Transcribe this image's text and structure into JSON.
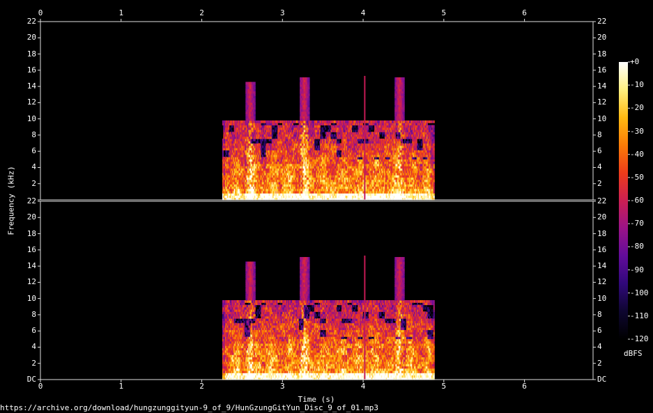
{
  "source_url": "https://archive.org/download/hungzunggityun-9_of_9/HunGzungGitYun_Disc_9_of_01.mp3",
  "chart_data": {
    "type": "heatmap",
    "subtype": "spectrogram",
    "channels": 2,
    "xlabel": "Time (s)",
    "ylabel": "Frequency (kHz)",
    "xlim": [
      0,
      6.85
    ],
    "ylim": [
      0,
      22
    ],
    "x_ticks": [
      "0",
      "1",
      "2",
      "3",
      "4",
      "5",
      "6"
    ],
    "y_ticks": [
      "DC",
      "2",
      "4",
      "6",
      "8",
      "10",
      "12",
      "14",
      "16",
      "18",
      "20",
      "22"
    ],
    "colorbar": {
      "unit": "dBFS",
      "range": [
        -120,
        0
      ],
      "ticks": [
        "+0",
        "-10",
        "-20",
        "-30",
        "-40",
        "-50",
        "-60",
        "-70",
        "-80",
        "-90",
        "-100",
        "-110",
        "-120"
      ],
      "colors": [
        "#000000",
        "#0e0630",
        "#30087a",
        "#620c9a",
        "#9a1388",
        "#cc1f52",
        "#ee3c1a",
        "#fa7c07",
        "#ffba12",
        "#fff080",
        "#ffffff"
      ]
    },
    "audio_segment": {
      "start_s": 2.25,
      "end_s": 4.88,
      "main_band_top_khz": 9.8
    },
    "features": [
      {
        "label": "transient",
        "time_s": 4.02,
        "top_khz": 15.3
      },
      {
        "label": "burst",
        "time_s": 2.6,
        "top_khz": 14.5
      },
      {
        "label": "burst",
        "time_s": 3.27,
        "top_khz": 15.0
      },
      {
        "label": "burst",
        "time_s": 4.45,
        "top_khz": 15.0
      }
    ],
    "grid": false,
    "legend": "colorbar-right"
  }
}
